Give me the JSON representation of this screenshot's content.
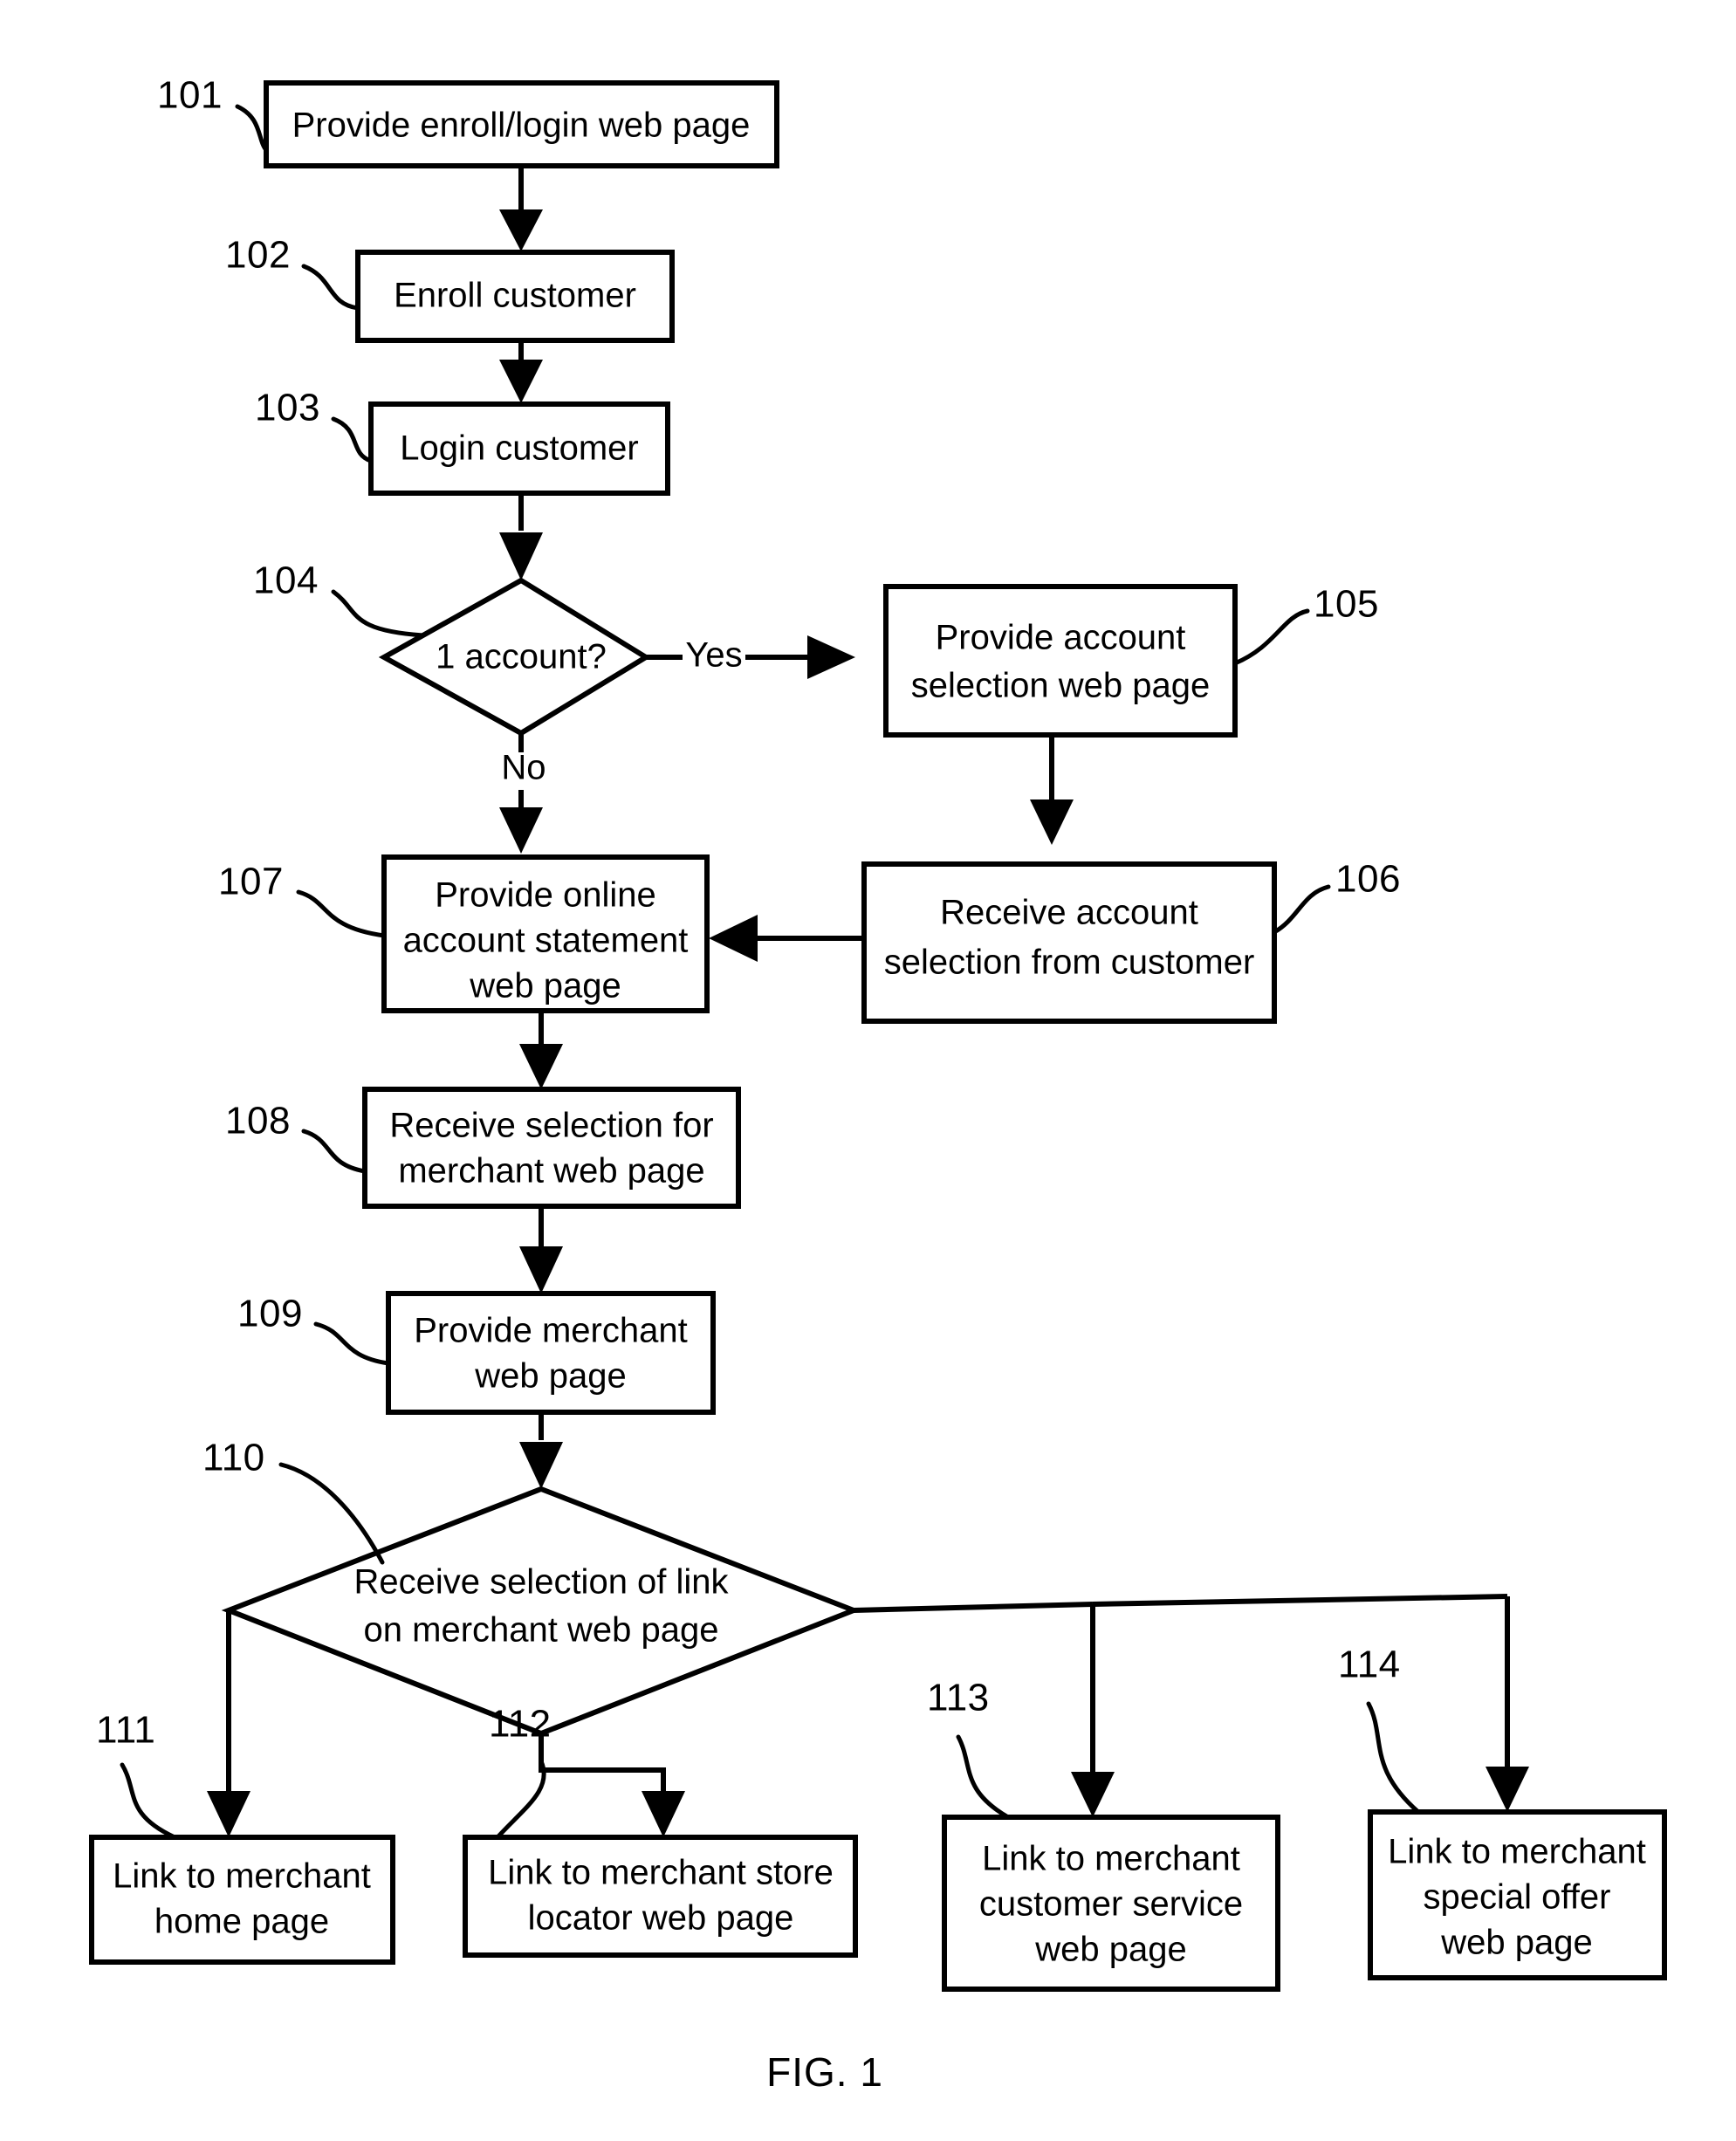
{
  "figure": {
    "caption": "FIG. 1",
    "type": "patent-flowchart",
    "page_background": "#ffffff",
    "ink_color": "#000000"
  },
  "nodes": [
    {
      "ref": "101",
      "shape": "process",
      "lines": [
        "Provide enroll/login web page"
      ]
    },
    {
      "ref": "102",
      "shape": "process",
      "lines": [
        "Enroll customer"
      ]
    },
    {
      "ref": "103",
      "shape": "process",
      "lines": [
        "Login customer"
      ]
    },
    {
      "ref": "104",
      "shape": "decision",
      "lines": [
        "1 account?"
      ]
    },
    {
      "ref": "105",
      "shape": "process",
      "lines": [
        "Provide account",
        "selection web page"
      ]
    },
    {
      "ref": "106",
      "shape": "process",
      "lines": [
        "Receive account",
        "selection from customer"
      ]
    },
    {
      "ref": "107",
      "shape": "process",
      "lines": [
        "Provide online",
        "account statement",
        "web page"
      ]
    },
    {
      "ref": "108",
      "shape": "process",
      "lines": [
        "Receive selection for",
        "merchant web page"
      ]
    },
    {
      "ref": "109",
      "shape": "process",
      "lines": [
        "Provide merchant",
        "web page"
      ]
    },
    {
      "ref": "110",
      "shape": "decision",
      "lines": [
        "Receive selection of link",
        "on merchant web page"
      ]
    },
    {
      "ref": "111",
      "shape": "process",
      "lines": [
        "Link to merchant",
        "home page"
      ]
    },
    {
      "ref": "112",
      "shape": "process",
      "lines": [
        "Link to merchant store",
        "locator web page"
      ]
    },
    {
      "ref": "113",
      "shape": "process",
      "lines": [
        "Link to merchant",
        "customer service",
        "web page"
      ]
    },
    {
      "ref": "114",
      "shape": "process",
      "lines": [
        "Link to merchant",
        "special offer",
        "web page"
      ]
    }
  ],
  "edge_labels": {
    "yes": "Yes",
    "no": "No"
  }
}
